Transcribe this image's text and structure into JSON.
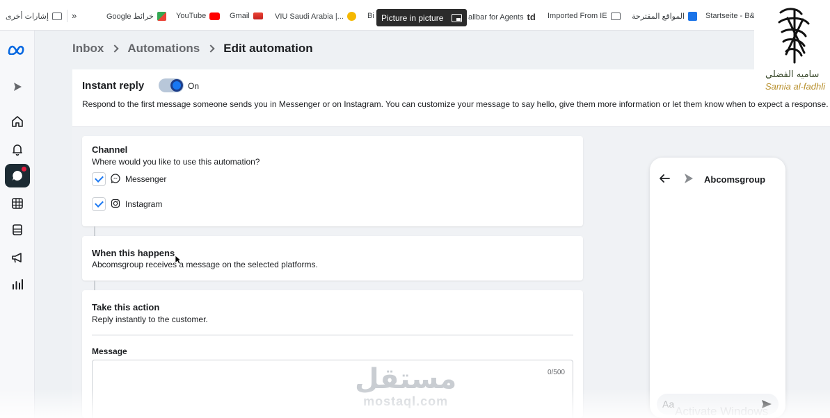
{
  "bookmarks_bar": {
    "items": [
      {
        "label": "إشارات أخرى",
        "icon": "folder-icon"
      },
      {
        "label": "»",
        "icon": ""
      },
      {
        "label": "Google خرائط",
        "icon": "google-maps-icon"
      },
      {
        "label": "YouTube",
        "icon": "youtube-icon"
      },
      {
        "label": "Gmail",
        "icon": "gmail-icon"
      },
      {
        "label": "VIU Saudi Arabia |...",
        "icon": "viu-icon"
      },
      {
        "label": "Bi",
        "icon": ""
      },
      {
        "label": "allbar for Agents",
        "icon": "td-icon"
      },
      {
        "label": "Imported From IE",
        "icon": "folder-icon"
      },
      {
        "label": "المواقع المقترحة",
        "icon": "bing-icon"
      },
      {
        "label": "Startseite - B&",
        "icon": ""
      }
    ],
    "pip_label": "Picture in picture"
  },
  "rail": {
    "icons": [
      "meta-logo-icon",
      "ads-icon",
      "home-icon",
      "bell-icon",
      "inbox-chat-icon",
      "table-icon",
      "pages-icon",
      "megaphone-icon",
      "insights-icon"
    ],
    "active": "inbox-chat-icon"
  },
  "breadcrumb": {
    "inbox": "Inbox",
    "automations": "Automations",
    "current": "Edit automation"
  },
  "instant_reply": {
    "title": "Instant reply",
    "toggle_state": "On",
    "description": "Respond to the first message someone sends you in Messenger or on Instagram. You can customize your message to say hello, give them more information or let them know when to expect a response."
  },
  "channel": {
    "title": "Channel",
    "subtitle": "Where would you like to use this automation?",
    "options": [
      {
        "label": "Messenger",
        "checked": true,
        "icon": "messenger-icon"
      },
      {
        "label": "Instagram",
        "checked": true,
        "icon": "instagram-icon"
      }
    ]
  },
  "trigger": {
    "title": "When this happens",
    "subtitle": "Abcomsgroup receives a message on the selected platforms."
  },
  "action": {
    "title": "Take this action",
    "subtitle": "Reply instantly to the customer.",
    "message_label": "Message",
    "message_value": "",
    "char_count": "0/500"
  },
  "preview": {
    "page_name": "Abcomsgroup",
    "compose_placeholder": "Aa"
  },
  "overlays": {
    "watermark_ar": "مستقل",
    "watermark_latin": "mostaql.com",
    "activate_windows": "Activate Windows",
    "logo_ar": "ساميه الفضلي",
    "logo_latin": "Samia al-fadhli"
  },
  "colors": {
    "accent": "#1877f2",
    "toggle_ring": "#1d3e8a",
    "background": "#f0f2f5"
  }
}
